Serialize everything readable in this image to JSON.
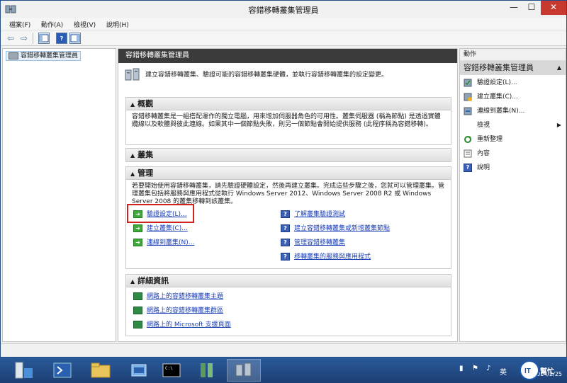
{
  "window": {
    "title": "容錯移轉叢集管理員",
    "minimize_glyph": "—",
    "maximize_glyph": "☐",
    "close_glyph": "✕"
  },
  "menu": {
    "items": [
      "檔案(F)",
      "動作(A)",
      "檢視(V)",
      "說明(H)"
    ]
  },
  "toolbar": {
    "back_glyph": "⇦",
    "forward_glyph": "⇨",
    "help_glyph": "?"
  },
  "tree": {
    "root_label": "容錯移轉叢集管理員"
  },
  "center": {
    "header": "容錯移轉叢集管理員",
    "intro": "建立容錯移轉叢集、驗證可能的容錯移轉叢集硬體，並執行容錯移轉叢集的設定變更。",
    "overview": {
      "title": "概觀",
      "text": "容錯移轉叢集是一組搭配運作的獨立電腦，用來增加伺服器角色的可用性。叢集伺服器 (稱為節點) 是透過實體纜線以及軟體與彼此連線。如果其中一個節點失敗，則另一個節點會開始提供服務 (此程序稱為容錯移轉)。"
    },
    "clusters": {
      "title": "叢集"
    },
    "management": {
      "title": "管理",
      "text": "若要開始使用容錯移轉叢集，請先驗證硬體設定，然後再建立叢集。完成這些步驟之後，您就可以管理叢集。管理叢集包括將服務與應用程式從執行 Windows Server 2012、Windows Server 2008 R2 或 Windows Server 2008 的叢集移轉到該叢集。",
      "left_links": [
        "驗證設定(L)...",
        "建立叢集(C)...",
        "連線到叢集(N)..."
      ],
      "right_links": [
        "了解叢集驗證測試",
        "建立容錯移轉叢集或新增叢集節點",
        "管理容錯移轉叢集",
        "移轉叢集的服務與應用程式"
      ]
    },
    "details": {
      "title": "詳細資訊",
      "links": [
        "網路上的容錯移轉叢集主題",
        "網路上的容錯移轉叢集群區",
        "網路上的 Microsoft 支援頁面"
      ]
    }
  },
  "actions": {
    "header": "動作",
    "subheader": "容錯移轉叢集管理員",
    "items": [
      "驗證設定(L)...",
      "建立叢集(C)...",
      "連線到叢集(N)...",
      "檢視",
      "重新整理",
      "內容",
      "說明"
    ]
  },
  "taskbar": {
    "ime_label": "英",
    "clock_text": "2014/2/25"
  },
  "colors": {
    "header_dark": "#3b3b3b",
    "link_blue": "#1a3fb5",
    "highlight_red": "#d0211d",
    "taskbar_blue": "#1c3f73"
  }
}
